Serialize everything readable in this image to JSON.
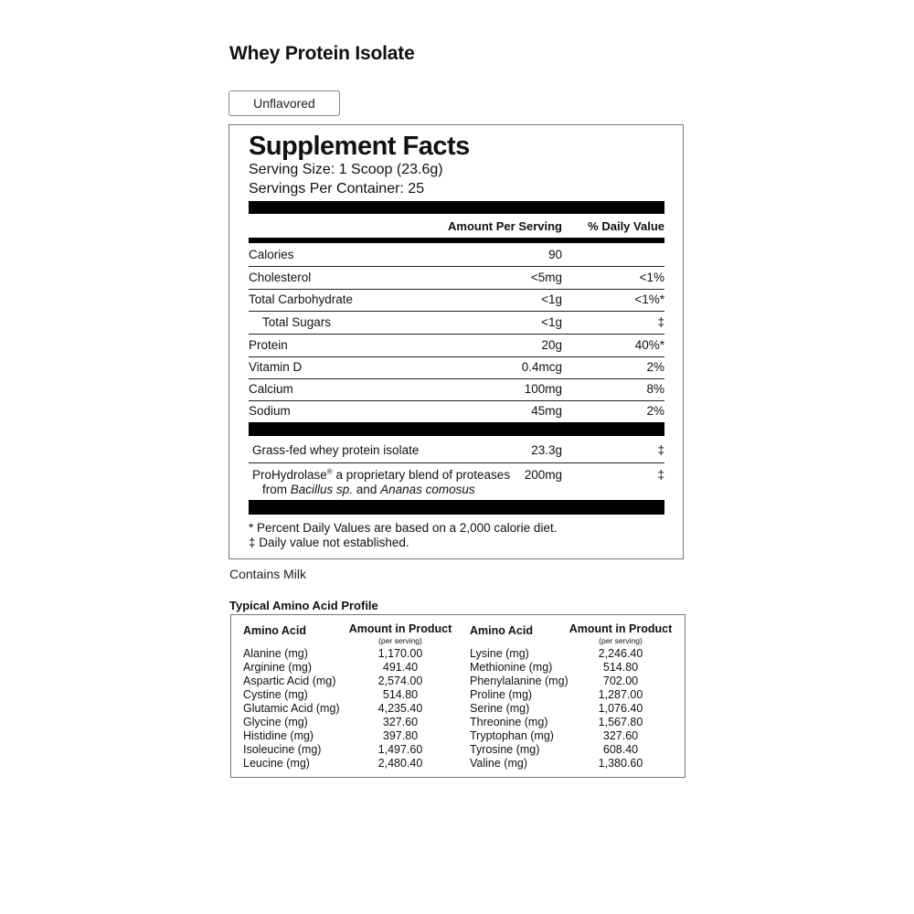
{
  "product": {
    "title": "Whey Protein Isolate",
    "flavor_selected": "Unflavored"
  },
  "supplement_facts": {
    "title": "Supplement Facts",
    "serving_size": "Serving Size: 1 Scoop (23.6g)",
    "servings_per_container": "Servings Per Container: 25",
    "header_amount": "Amount Per Serving",
    "header_dv": "% Daily Value",
    "rows": [
      {
        "name": "Calories",
        "amount": "90",
        "dv": ""
      },
      {
        "name": "Cholesterol",
        "amount": "<5mg",
        "dv": "<1%"
      },
      {
        "name": "Total Carbohydrate",
        "amount": "<1g",
        "dv": "<1%*"
      },
      {
        "name": "Total Sugars",
        "amount": "<1g",
        "dv": "‡"
      },
      {
        "name": "Protein",
        "amount": "20g",
        "dv": "40%*"
      },
      {
        "name": "Vitamin D",
        "amount": "0.4mcg",
        "dv": "2%"
      },
      {
        "name": "Calcium",
        "amount": "100mg",
        "dv": "8%"
      },
      {
        "name": "Sodium",
        "amount": "45mg",
        "dv": "2%"
      }
    ],
    "other_ingredients": [
      {
        "name": "Grass-fed whey protein isolate",
        "amount": "23.3g",
        "dv": "‡"
      }
    ],
    "blend": {
      "name": "ProHydrolase",
      "registered_mark": "®",
      "rest": " a proprietary blend of proteases",
      "line2_prefix": "from ",
      "source_1": "Bacillus sp.",
      "joiner": " and ",
      "source_2": "Ananas comosus",
      "amount": "200mg",
      "dv": "‡"
    },
    "footnote_1": "* Percent Daily Values are based on a 2,000 calorie diet.",
    "footnote_2": "‡ Daily value not established."
  },
  "allergen": "Contains Milk",
  "amino_profile": {
    "title": "Typical Amino Acid Profile",
    "header_name": "Amino Acid",
    "header_amount": "Amount in Product",
    "header_sub": "(per serving)",
    "left": [
      {
        "name": "Alanine (mg)",
        "value": "1,170.00"
      },
      {
        "name": "Arginine (mg)",
        "value": "491.40"
      },
      {
        "name": "Aspartic Acid (mg)",
        "value": "2,574.00"
      },
      {
        "name": "Cystine (mg)",
        "value": "514.80"
      },
      {
        "name": "Glutamic Acid (mg)",
        "value": "4,235.40"
      },
      {
        "name": "Glycine (mg)",
        "value": "327.60"
      },
      {
        "name": "Histidine (mg)",
        "value": "397.80"
      },
      {
        "name": "Isoleucine (mg)",
        "value": "1,497.60"
      },
      {
        "name": "Leucine (mg)",
        "value": "2,480.40"
      }
    ],
    "right": [
      {
        "name": "Lysine (mg)",
        "value": "2,246.40"
      },
      {
        "name": "Methionine (mg)",
        "value": "514.80"
      },
      {
        "name": "Phenylalanine (mg)",
        "value": "702.00"
      },
      {
        "name": "Proline (mg)",
        "value": "1,287.00"
      },
      {
        "name": "Serine (mg)",
        "value": "1,076.40"
      },
      {
        "name": "Threonine (mg)",
        "value": "1,567.80"
      },
      {
        "name": "Tryptophan (mg)",
        "value": "327.60"
      },
      {
        "name": "Tyrosine (mg)",
        "value": "608.40"
      },
      {
        "name": "Valine (mg)",
        "value": "1,380.60"
      }
    ]
  }
}
